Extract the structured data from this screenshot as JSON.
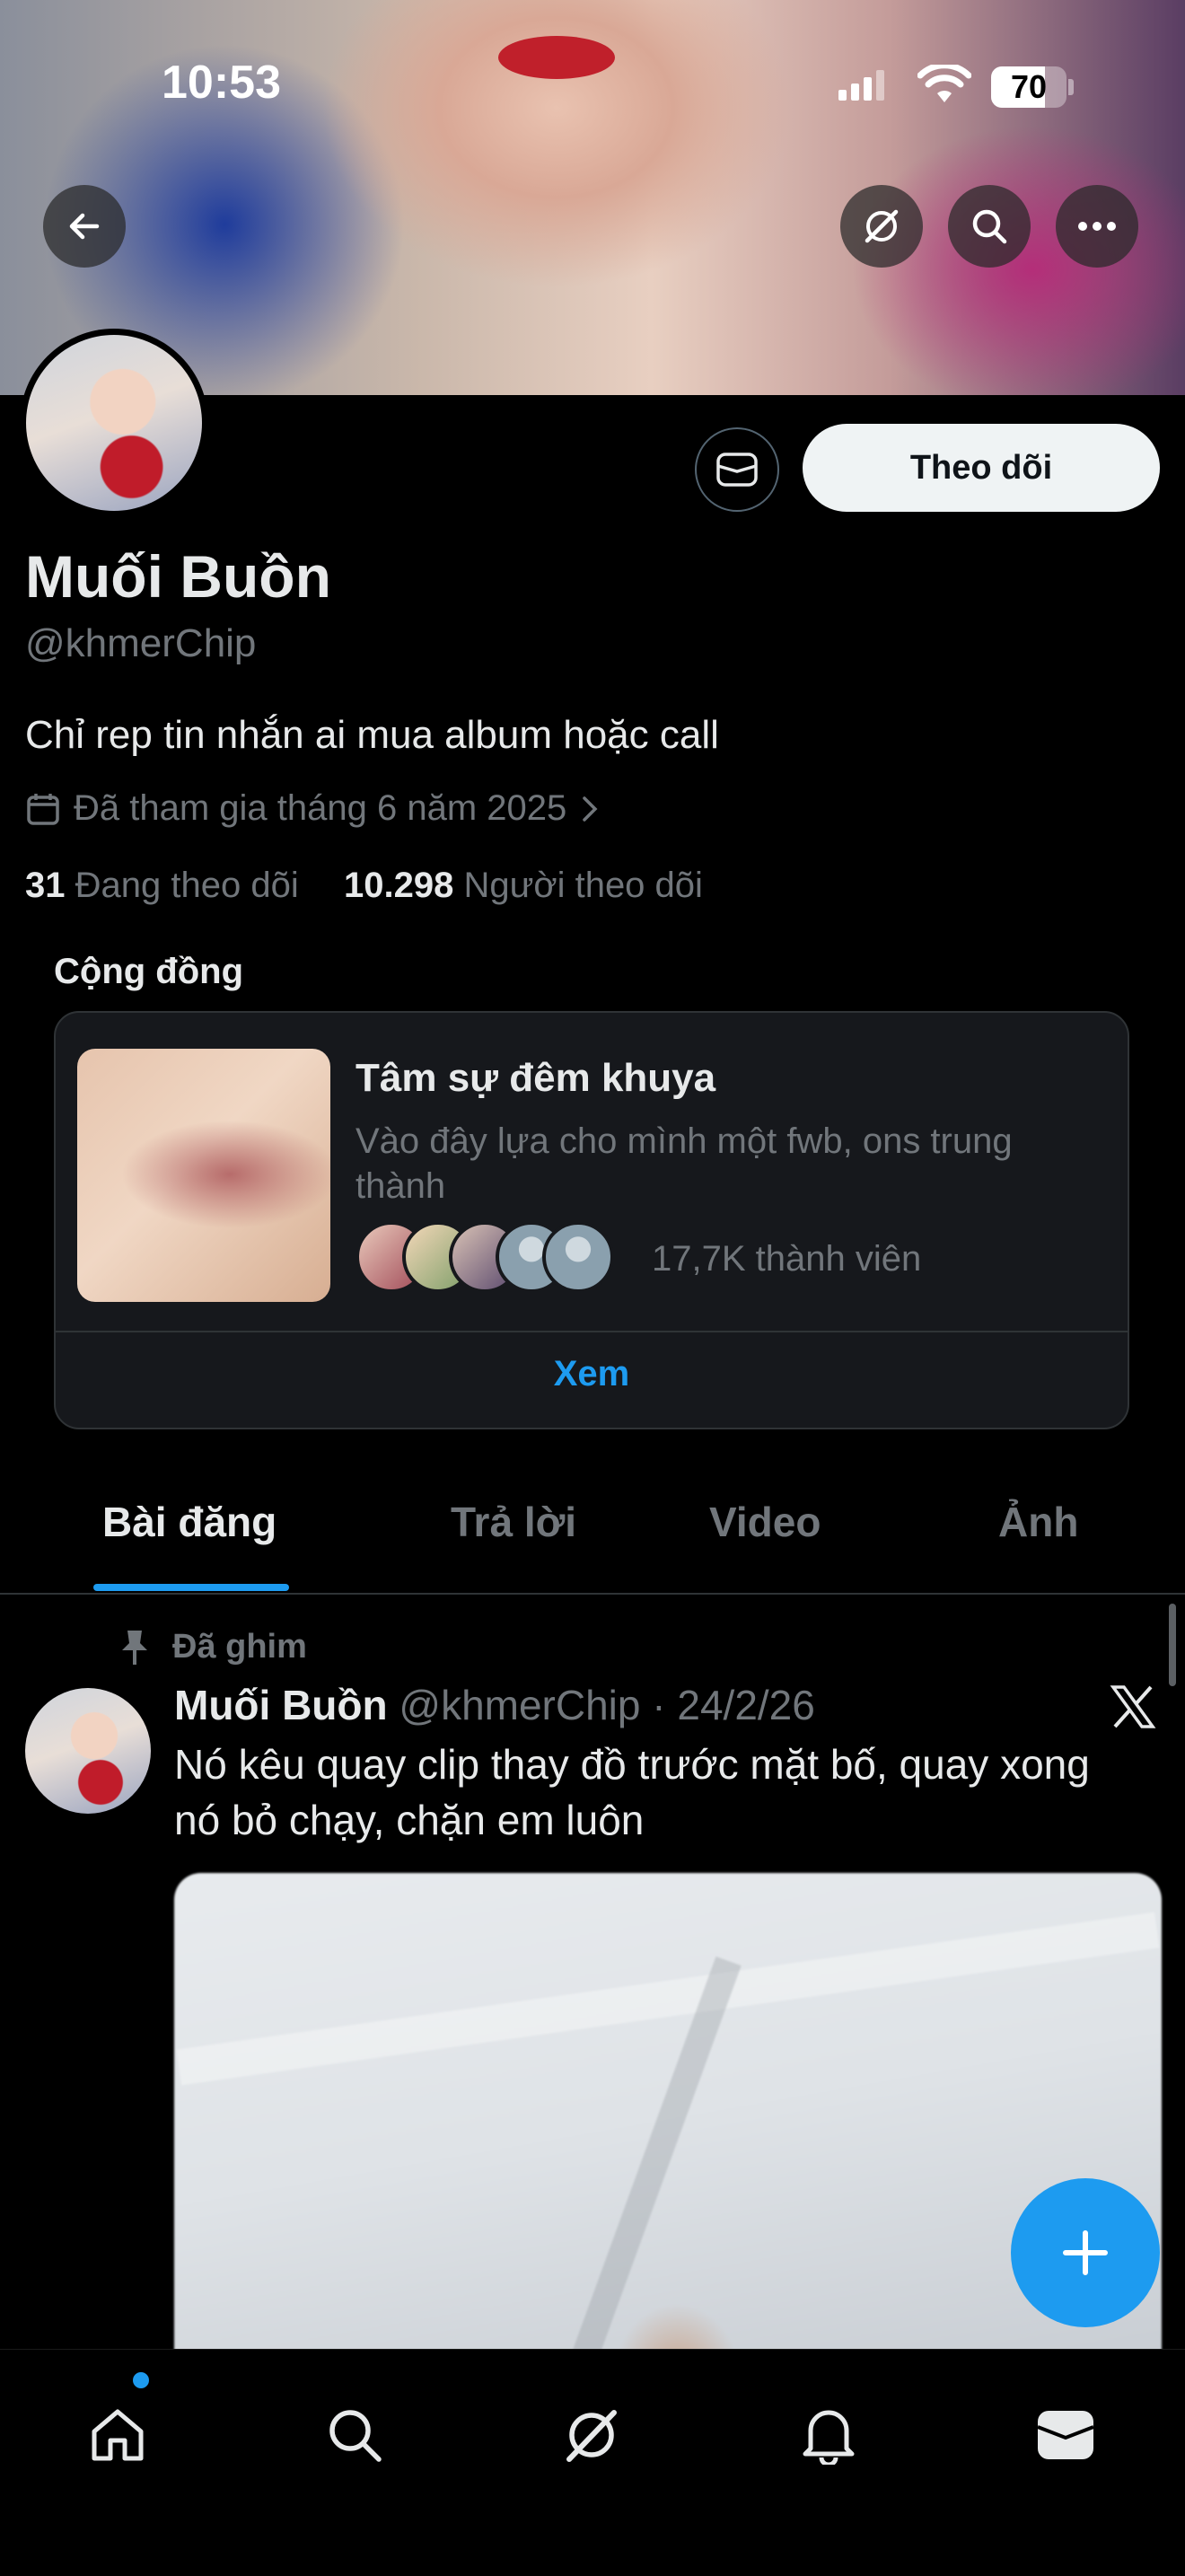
{
  "status": {
    "time": "10:53",
    "battery": "70"
  },
  "profile": {
    "name": "Muối Buồn",
    "handle": "@khmerChip",
    "bio": "Chỉ rep tin nhắn ai mua album hoặc call",
    "joined": "Đã tham gia tháng 6 năm 2025",
    "following_count": "31",
    "following_label": "Đang theo dõi",
    "followers_count": "10.298",
    "followers_label": "Người theo dõi",
    "follow_button": "Theo dõi"
  },
  "community": {
    "section_title": "Cộng đồng",
    "name": "Tâm sự đêm khuya",
    "description": "Vào đây lựa cho mình một fwb, ons trung thành",
    "members": "17,7K thành viên",
    "view_button": "Xem"
  },
  "tabs": [
    "Bài đăng",
    "Trả lời",
    "Video",
    "Ảnh"
  ],
  "post": {
    "pinned_label": "Đã ghim",
    "author": "Muối Buồn",
    "handle": "@khmerChip",
    "sep": "·",
    "date": "24/2/26",
    "text": "Nó kêu quay clip thay đồ trước mặt bố, quay xong nó bỏ chạy, chặn em luôn"
  },
  "colors": {
    "accent": "#1d9bf0",
    "background": "#000000",
    "muted": "#71767b"
  }
}
